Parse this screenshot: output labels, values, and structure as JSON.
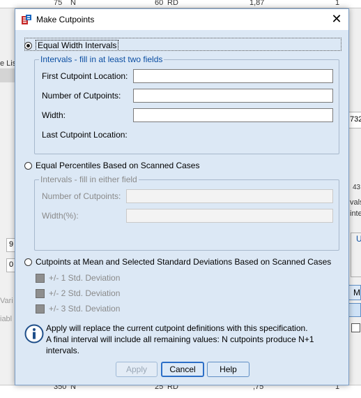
{
  "background": {
    "top_row": {
      "num": "75",
      "unit": "N",
      "val": "60",
      "code": "RD",
      "dec": "1,87",
      "last": "1"
    },
    "bottom_row": {
      "num": "350",
      "unit": "N",
      "val": "25",
      "code": "RD",
      "dec": ",75",
      "last": "1"
    },
    "left_fragments": [
      "e Lis",
      "Vari",
      "iabl"
    ],
    "left_boxes": [
      "9",
      "0"
    ],
    "right_fragments": [
      "732",
      "43",
      "vals",
      "inte",
      "U",
      "M"
    ]
  },
  "dialog": {
    "title": "Make Cutpoints",
    "close_glyph": "✕",
    "equal_width": {
      "label": "Equal Width Intervals",
      "selected": true,
      "group_title": "Intervals - fill in at least two fields",
      "fields": [
        {
          "label": "First Cutpoint Location:",
          "value": ""
        },
        {
          "label": "Number of Cutpoints:",
          "value": ""
        },
        {
          "label": "Width:",
          "value": ""
        }
      ],
      "last_cutpoint_label": "Last Cutpoint Location:"
    },
    "equal_percentiles": {
      "label": "Equal Percentiles Based on Scanned Cases",
      "selected": false,
      "group_title": "Intervals - fill in either field",
      "fields": [
        {
          "label": "Number of Cutpoints:",
          "value": ""
        },
        {
          "label": "Width(%):",
          "value": ""
        }
      ]
    },
    "mean_sd": {
      "label": "Cutpoints at Mean and Selected Standard Deviations Based on Scanned Cases",
      "selected": false,
      "options": [
        "+/- 1 Std. Deviation",
        "+/- 2 Std. Deviation",
        "+/- 3 Std. Deviation"
      ]
    },
    "info": {
      "icon": "info-icon",
      "lines": [
        "Apply will replace the current cutpoint definitions with this specification.",
        "A final interval will include all remaining values: N cutpoints produce N+1",
        "intervals."
      ]
    },
    "buttons": {
      "apply": "Apply",
      "cancel": "Cancel",
      "help": "Help"
    }
  }
}
